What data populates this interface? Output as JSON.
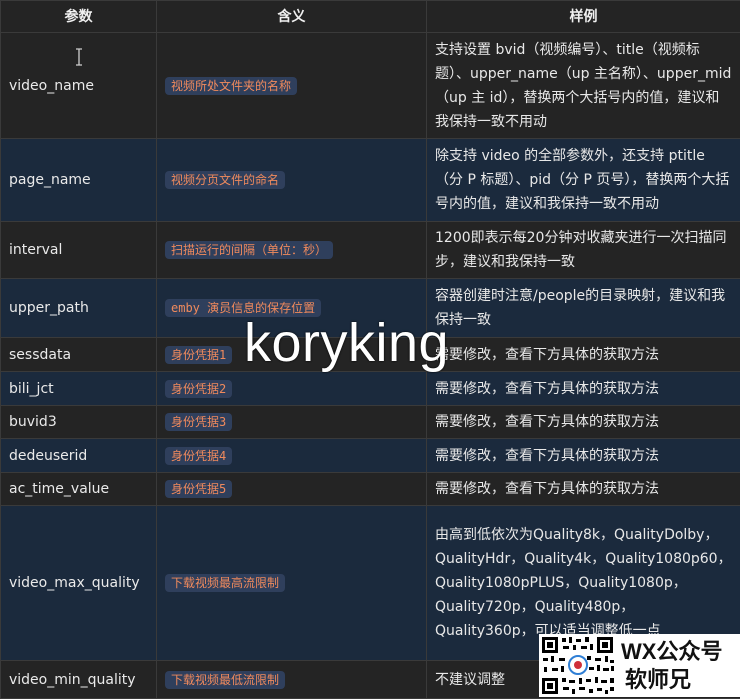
{
  "table": {
    "headers": [
      "参数",
      "含义",
      "样例"
    ],
    "rows": [
      {
        "name": "video_name",
        "meaning": "视频所处文件夹的名称",
        "example": "支持设置 bvid（视频编号）、title（视频标题）、upper_name（up 主名称）、upper_mid（up 主 id），替换两个大括号内的值，建议和我保持一致不用动"
      },
      {
        "name": "page_name",
        "meaning": "视频分页文件的命名",
        "example": "除支持 video 的全部参数外，还支持 ptitle（分 P 标题）、pid（分 P 页号），替换两个大括号内的值，建议和我保持一致不用动"
      },
      {
        "name": "interval",
        "meaning": "扫描运行的间隔（单位：秒）",
        "example": "1200即表示每20分钟对收藏夹进行一次扫描同步，建议和我保持一致"
      },
      {
        "name": "upper_path",
        "meaning": "emby 演员信息的保存位置",
        "example": "容器创建时注意/people的目录映射，建议和我保持一致"
      },
      {
        "name": "sessdata",
        "meaning": "身份凭据1",
        "example": "需要修改，查看下方具体的获取方法"
      },
      {
        "name": "bili_jct",
        "meaning": "身份凭据2",
        "example": "需要修改，查看下方具体的获取方法"
      },
      {
        "name": "buvid3",
        "meaning": "身份凭据3",
        "example": "需要修改，查看下方具体的获取方法"
      },
      {
        "name": "dedeuserid",
        "meaning": "身份凭据4",
        "example": "需要修改，查看下方具体的获取方法"
      },
      {
        "name": "ac_time_value",
        "meaning": "身份凭据5",
        "example": "需要修改，查看下方具体的获取方法"
      },
      {
        "name": "video_max_quality",
        "meaning": "下载视频最高流限制",
        "example": "由高到低依次为Quality8k，QualityDolby，QualityHdr，Quality4k，Quality1080p60，Quality1080pPLUS，Quality1080p，Quality720p，Quality480p，Quality360p，可以适当调整低一点"
      },
      {
        "name": "video_min_quality",
        "meaning": "下载视频最低流限制",
        "example": "不建议调整"
      }
    ]
  },
  "watermark": "koryking",
  "brand": {
    "line1": "WX公众号",
    "line2": "软师兄"
  },
  "colors": {
    "tag_text": "#f08a5d",
    "tag_bg": "#2f3f5c",
    "row_alt": "#1b2a3d"
  }
}
